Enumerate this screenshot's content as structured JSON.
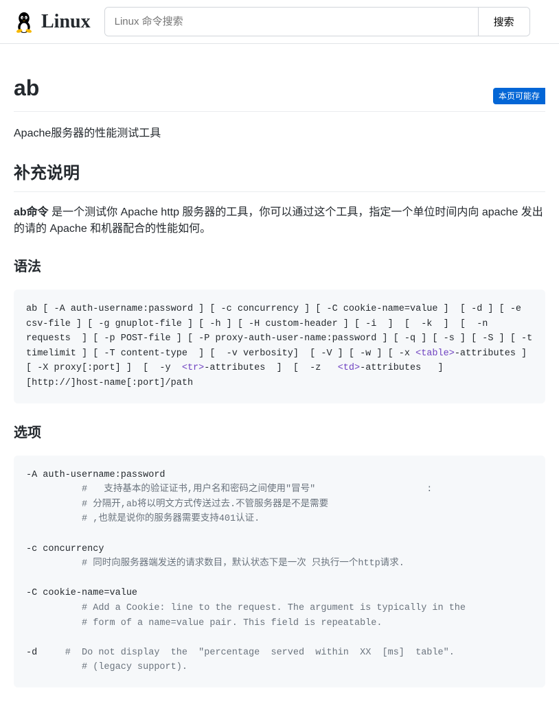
{
  "header": {
    "logo_text": "Linux",
    "search_placeholder": "Linux 命令搜索",
    "search_button": "搜索"
  },
  "page": {
    "title": "ab",
    "badge": "本页可能存",
    "subtitle": "Apache服务器的性能测试工具",
    "h2_supplement": "补充说明",
    "desc_strong": "ab命令",
    "desc_rest": " 是一个测试你 Apache http 服务器的工具，你可以通过这个工具，指定一个单位时间内向 apache 发出的请的 Apache 和机器配合的性能如何。",
    "h3_syntax": "语法",
    "h3_options": "选项"
  },
  "syntax_code": "ab [ -A auth-username:password ] [ -c concurrency ] [ -C cookie-name=value ]  [ -d ] [ -e csv-file ] [ -g gnuplot-file ] [ -h ] [ -H custom-header ] [ -i  ]  [  -k  ]  [  -n  requests  ] [ -p POST-file ] [ -P proxy-auth-user-name:password ] [ -q ] [ -s ] [ -S ] [ -t timelimit ] [ -T content-type  ] [  -v verbosity]  [ -V ] [ -w ] [ -x <table>-attributes ] [ -X proxy[:port] ]  [  -y  <tr>-attributes  ]  [  -z   <td>-attributes   ]   [http://]host-name[:port]/path",
  "options_code": {
    "l1": "-A auth-username:password",
    "l2": "          #   支持基本的验证证书,用户名和密码之间使用\"冒号\"                    :",
    "l3": "          # 分隔开,ab将以明文方式传送过去.不管服务器是不是需要",
    "l4": "          # ,也就是说你的服务器需要支持401认证.",
    "l5": "",
    "l6": "-c concurrency",
    "l7": "          # 同时向服务器端发送的请求数目，默认状态下是一次 只执行一个http请求.",
    "l8": "",
    "l9": "-C cookie-name=value",
    "l10": "          # Add a Cookie: line to the request. The argument is typically in the",
    "l11": "          # form of a name=value pair. This field is repeatable.",
    "l12": "",
    "l13": "-d     #  Do not display  the  \"percentage  served  within  XX  [ms]  table\".",
    "l14": "          # (legacy support)."
  }
}
